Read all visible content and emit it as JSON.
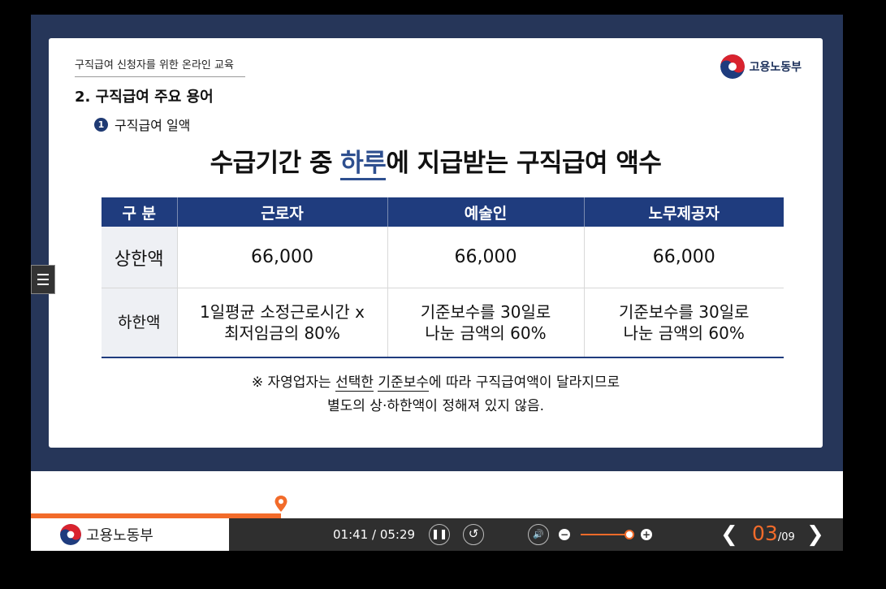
{
  "slide": {
    "course_title": "구직급여 신청자를 위한 온라인 교육",
    "ministry": "고용노동부",
    "section_title": "2. 구직급여 주요 용어",
    "sub_number": "1",
    "sub_title": "구직급여 일액",
    "headline_pre": "수급기간 중 ",
    "headline_hl": "하루",
    "headline_post": "에 지급받는 구직급여 액수",
    "table": {
      "headers": [
        "구 분",
        "근로자",
        "예술인",
        "노무제공자"
      ],
      "rows": [
        {
          "label": "상한액",
          "cells": [
            "66,000",
            "66,000",
            "66,000"
          ]
        },
        {
          "label": "하한액",
          "cells": [
            [
              "1일평균 소정근로시간 x",
              "최저임금의 80%"
            ],
            [
              "기준보수를 30일로",
              "나눈 금액의 60%"
            ],
            [
              "기준보수를 30일로",
              "나눈 금액의 60%"
            ]
          ]
        }
      ]
    },
    "note_pre": "※ 자영업자는 ",
    "note_u1": "선택한",
    "note_sp": " ",
    "note_u2": "기준보수",
    "note_post": "에 따라 구직급여액이 달라지므로",
    "note_line2": "별도의 상·하한액이 정해져 있지 않음."
  },
  "player": {
    "ministry": "고용노동부",
    "time": "01:41 / 05:29",
    "progress_fraction": 0.308,
    "volume_fraction": 0.9,
    "page_current": "03",
    "page_total": "/09",
    "accent_color": "#f26b2a",
    "navy_color": "#1f3c7e"
  }
}
